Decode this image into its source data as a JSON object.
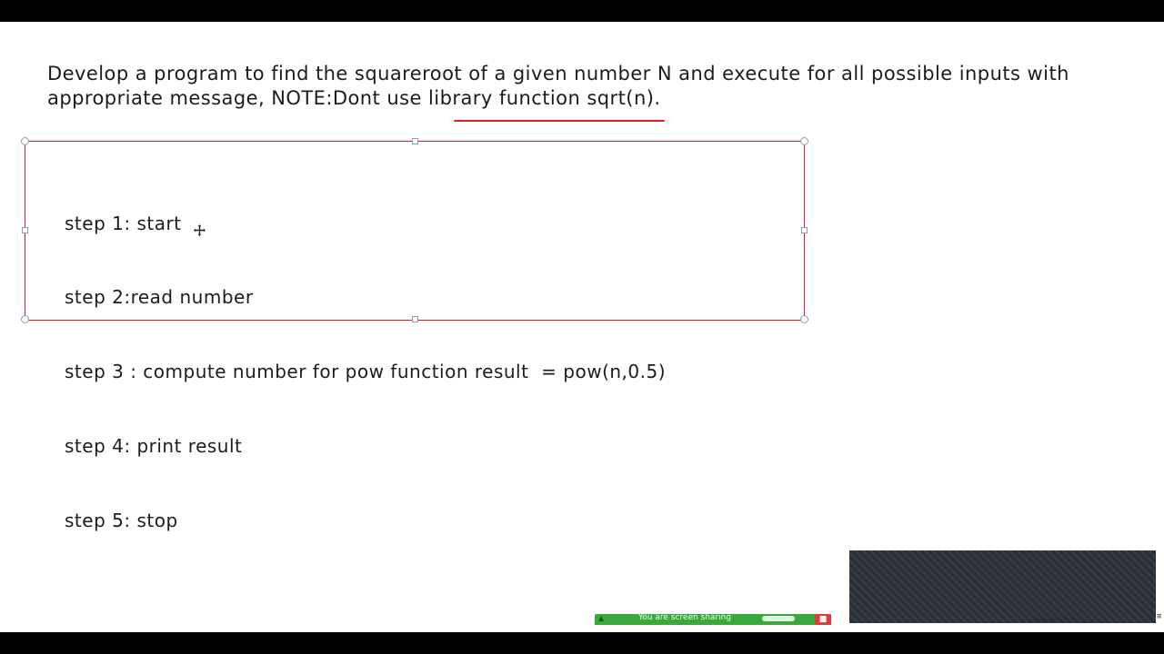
{
  "slide": {
    "problem_line1": "Develop a program to find the squareroot of a given number N and execute for all possible inputs with",
    "problem_line2": "appropriate message, NOTE:Dont use library function sqrt(n).",
    "steps": [
      "step 1: start",
      "step 2:read number",
      "step 3 : compute number for pow function result  = pow(n,0.5)",
      "step 4: print result",
      "step 5: stop"
    ]
  },
  "annotation": {
    "underline_color": "#e02020"
  },
  "textbox": {
    "border_color": "#d31f2a"
  },
  "share_bar": {
    "text": "You are screen sharing",
    "icon": "screen-share-icon",
    "close_icon": "close-icon"
  },
  "colors": {
    "frame": "#000000",
    "share_green": "#3aa83a",
    "share_red": "#e23a3a"
  }
}
